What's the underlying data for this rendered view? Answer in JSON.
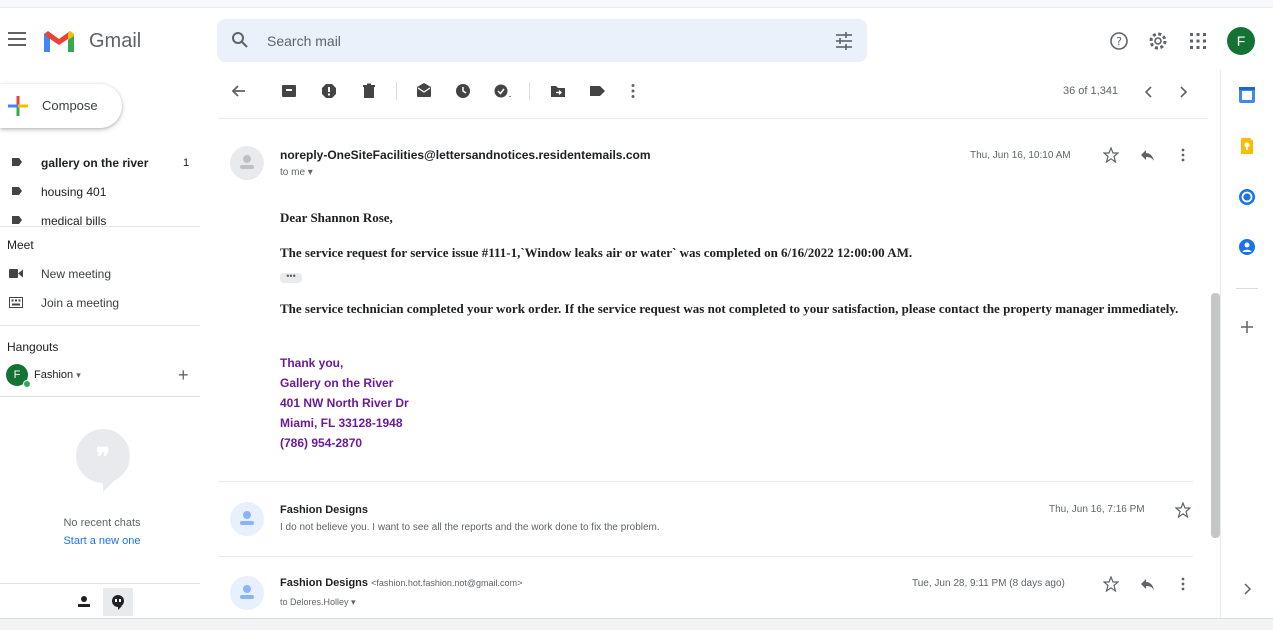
{
  "app": {
    "brand": "Gmail"
  },
  "search": {
    "placeholder": "Search mail"
  },
  "account": {
    "initial": "F"
  },
  "compose": {
    "label": "Compose"
  },
  "labels": [
    {
      "name": "gallery on the river",
      "count": "1",
      "bold": true
    },
    {
      "name": "housing 401",
      "count": "",
      "bold": false
    },
    {
      "name": "medical bills",
      "count": "",
      "bold": false
    }
  ],
  "meet": {
    "title": "Meet",
    "new_meeting": "New meeting",
    "join_meeting": "Join a meeting"
  },
  "hangouts": {
    "title": "Hangouts",
    "user_initial": "F",
    "user_name": "Fashion",
    "no_chats": "No recent chats",
    "start_new": "Start a new one"
  },
  "toolbar": {
    "pager": "36 of 1,341"
  },
  "messages": [
    {
      "from": "noreply-OneSiteFacilities@lettersandnotices.residentemails.com",
      "to": "to me",
      "date": "Thu, Jun 16, 10:10 AM",
      "greeting": "Dear Shannon Rose,",
      "line1": "The service request for service issue #111-1,`Window leaks air or water` was completed on 6/16/2022 12:00:00 AM.",
      "ellipsis": "•••",
      "line2": "The service technician completed your work order. If the service request was not completed to your satisfaction, please contact the property manager immediately.",
      "signature": [
        "Thank you,",
        "Gallery on the River",
        "401 NW North River Dr",
        "Miami, FL 33128-1948",
        "(786) 954-2870"
      ]
    },
    {
      "from": "Fashion Designs",
      "snippet": "I do not believe you. I want to see all the reports and the work done to fix the problem.",
      "date": "Thu, Jun 16, 7:16 PM"
    },
    {
      "from": "Fashion Designs",
      "email": "<fashion.hot.fashion.not@gmail.com>",
      "to": "to Delores.Holley",
      "date": "Tue, Jun 28, 9:11 PM (8 days ago)"
    }
  ],
  "colors": {
    "signature": "#6a1b9a",
    "link": "#1a73e8",
    "avatar": "#137333"
  },
  "icons": [
    "menu-icon",
    "gmail-logo",
    "search-icon",
    "filter-icon",
    "help-icon",
    "settings-icon",
    "apps-icon",
    "back-icon",
    "archive-icon",
    "report-spam-icon",
    "delete-icon",
    "mark-unread-icon",
    "snooze-icon",
    "add-task-icon",
    "move-to-icon",
    "label-icon",
    "more-icon",
    "newer-icon",
    "older-icon",
    "star-icon",
    "reply-icon",
    "calendar-icon",
    "keep-icon",
    "tasks-icon",
    "contacts-icon",
    "add-app-icon",
    "expand-panel-icon"
  ]
}
